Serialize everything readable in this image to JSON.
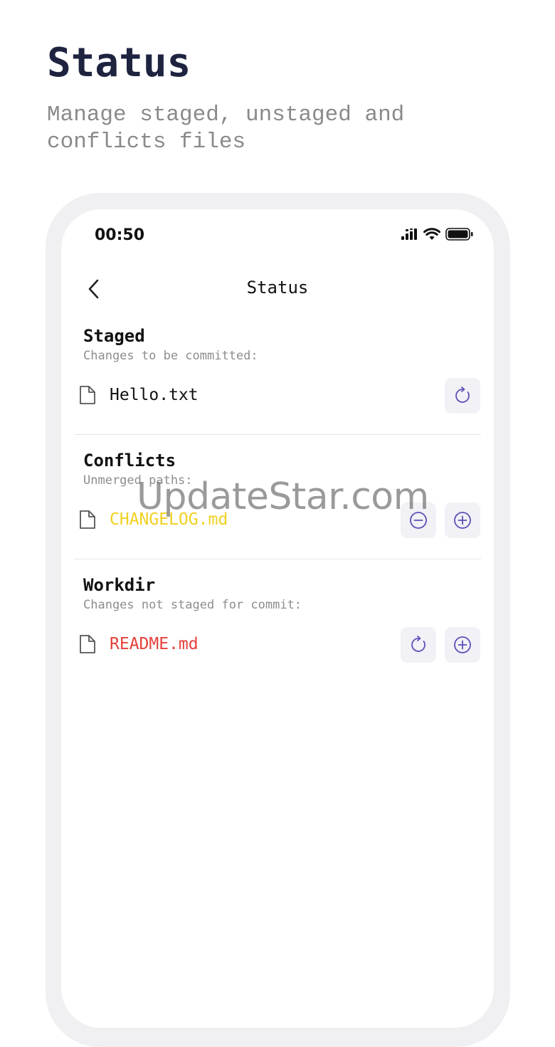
{
  "header": {
    "title": "Status",
    "subtitle": "Manage staged, unstaged and conflicts files"
  },
  "phone": {
    "time": "00:50",
    "nav_title": "Status",
    "sections": {
      "staged": {
        "title": "Staged",
        "subtitle": "Changes to be committed:",
        "file": "Hello.txt"
      },
      "conflicts": {
        "title": "Conflicts",
        "subtitle": "Unmerged paths:",
        "file": "CHANGELOG.md"
      },
      "workdir": {
        "title": "Workdir",
        "subtitle": "Changes not staged for commit:",
        "file": "README.md"
      }
    }
  },
  "icons": {
    "back": "chevron-left-icon",
    "file": "file-icon",
    "reset": "rotate-cw-icon",
    "remove": "minus-circle-icon",
    "add": "plus-circle-icon",
    "signal": "signal-icon",
    "wifi": "wifi-icon",
    "battery": "battery-icon"
  },
  "colors": {
    "accent": "#5a4fb8",
    "conflict_file": "#f0d020",
    "workdir_file": "#e5403a",
    "staged_file": "#111111"
  },
  "watermark": "UpdateStar.com"
}
